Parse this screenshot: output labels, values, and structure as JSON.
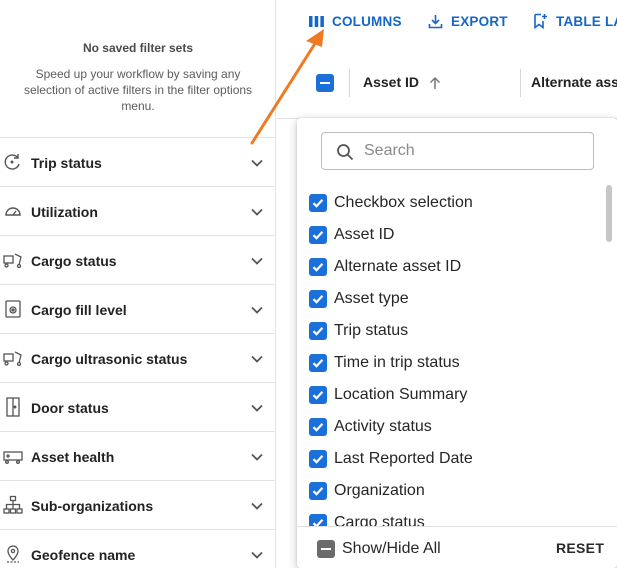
{
  "saved_filters": {
    "empty_title": "No saved filter sets",
    "empty_description": "Speed up your workflow by saving any selection of active filters in the filter options menu."
  },
  "filters": [
    {
      "label": "Trip status",
      "icon": "trip-status-icon"
    },
    {
      "label": "Utilization",
      "icon": "gauge-icon"
    },
    {
      "label": "Cargo status",
      "icon": "cargo-icon"
    },
    {
      "label": "Cargo fill level",
      "icon": "fill-level-icon"
    },
    {
      "label": "Cargo ultrasonic status",
      "icon": "cargo-ultrasonic-icon"
    },
    {
      "label": "Door status",
      "icon": "door-icon"
    },
    {
      "label": "Asset health",
      "icon": "asset-health-icon"
    },
    {
      "label": "Sub-organizations",
      "icon": "org-tree-icon"
    },
    {
      "label": "Geofence name",
      "icon": "geofence-pin-icon"
    }
  ],
  "toolbar": {
    "columns_label": "COLUMNS",
    "export_label": "EXPORT",
    "table_layout_label": "TABLE LA"
  },
  "grid": {
    "columns": [
      "Asset ID",
      "Alternate ass"
    ]
  },
  "column_picker": {
    "search_placeholder": "Search",
    "columns": [
      {
        "label": "Checkbox selection",
        "checked": true
      },
      {
        "label": "Asset ID",
        "checked": true
      },
      {
        "label": "Alternate asset ID",
        "checked": true
      },
      {
        "label": "Asset type",
        "checked": true
      },
      {
        "label": "Trip status",
        "checked": true
      },
      {
        "label": "Time in trip status",
        "checked": true
      },
      {
        "label": "Location Summary",
        "checked": true
      },
      {
        "label": "Activity status",
        "checked": true
      },
      {
        "label": "Last Reported Date",
        "checked": true
      },
      {
        "label": "Organization",
        "checked": true
      },
      {
        "label": "Cargo status",
        "checked": true
      }
    ],
    "show_hide_all_label": "Show/Hide All",
    "reset_label": "RESET"
  },
  "colors": {
    "accent": "#1466c7",
    "checkbox": "#1a6fd8",
    "annotation_arrow": "#f07a22"
  }
}
